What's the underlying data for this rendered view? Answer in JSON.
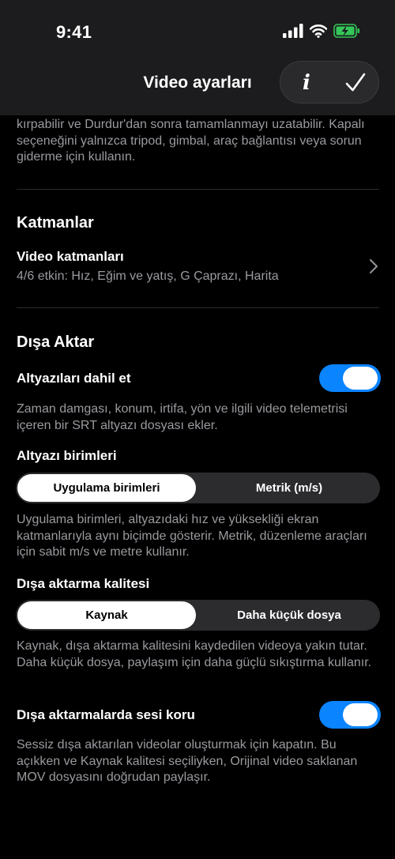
{
  "status": {
    "time": "9:41"
  },
  "header": {
    "title": "Video ayarları"
  },
  "intro_text": "kırpabilir ve Durdur'dan sonra tamamlanmayı uzatabilir. Kapalı seçeneğini yalnızca tripod, gimbal, araç bağlantısı veya sorun giderme için kullanın.",
  "layers": {
    "section_title": "Katmanlar",
    "row_title": "Video katmanları",
    "row_subtitle": "4/6 etkin: Hız, Eğim ve yatış, G Çaprazı, Harita"
  },
  "export": {
    "section_title": "Dışa Aktar",
    "subtitles_label": "Altyazıları dahil et",
    "subtitles_desc": "Zaman damgası, konum, irtifa, yön ve ilgili video telemetrisi içeren bir SRT altyazı dosyası ekler.",
    "units_label": "Altyazı birimleri",
    "units_options": [
      "Uygulama birimleri",
      "Metrik (m/s)"
    ],
    "units_desc": "Uygulama birimleri, altyazıdaki hız ve yüksekliği ekran katmanlarıyla aynı biçimde gösterir. Metrik, düzenleme araçları için sabit m/s ve metre kullanır.",
    "quality_label": "Dışa aktarma kalitesi",
    "quality_options": [
      "Kaynak",
      "Daha küçük dosya"
    ],
    "quality_desc": "Kaynak, dışa aktarma kalitesini kaydedilen videoya yakın tutar. Daha küçük dosya, paylaşım için daha güçlü sıkıştırma kullanır.",
    "audio_label": "Dışa aktarmalarda sesi koru",
    "audio_desc": "Sessiz dışa aktarılan videolar oluşturmak için kapatın. Bu açıkken ve Kaynak kalitesi seçiliyken, Orijinal video saklanan MOV dosyasını doğrudan paylaşır."
  },
  "colors": {
    "accent": "#0a84ff",
    "battery": "#34c759",
    "background": "#000000",
    "header_bg": "#1c1c1e"
  }
}
